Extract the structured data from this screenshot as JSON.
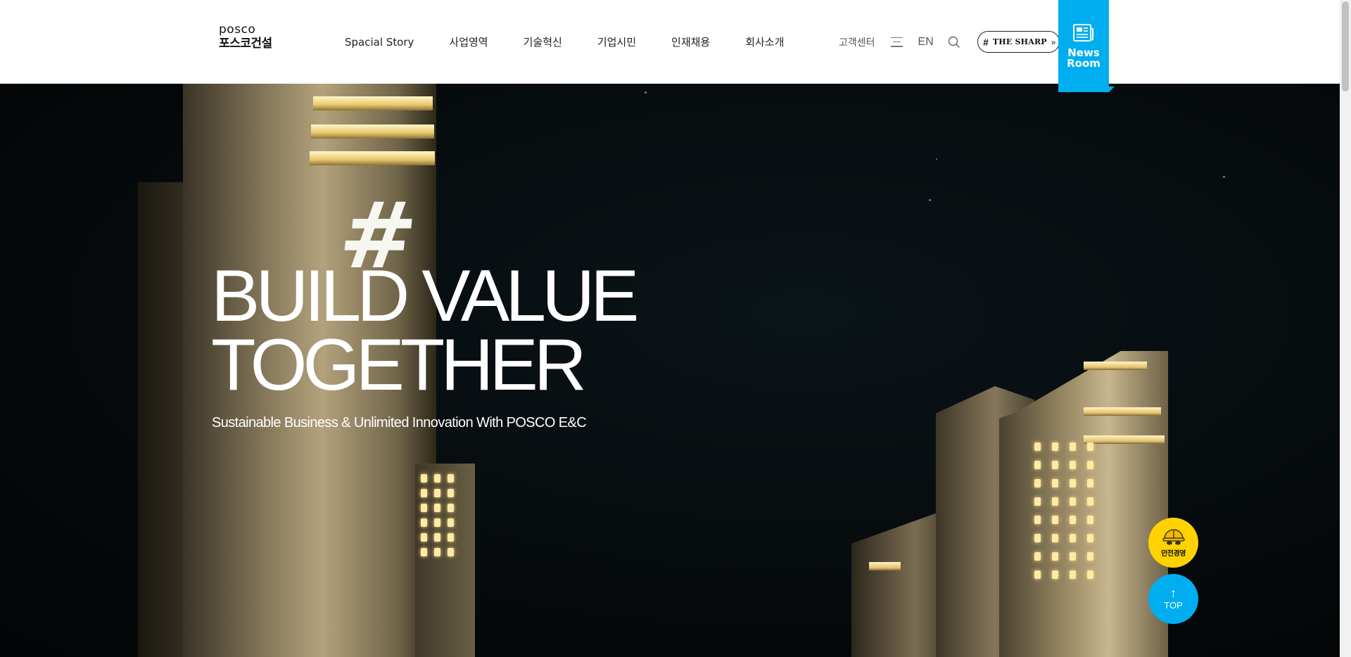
{
  "header": {
    "logo_en": "posco",
    "logo_kr": "포스코건설",
    "nav": [
      {
        "label": "Spacial Story"
      },
      {
        "label": "사업영역"
      },
      {
        "label": "기술혁신"
      },
      {
        "label": "기업시민"
      },
      {
        "label": "인재채용"
      },
      {
        "label": "회사소개"
      }
    ],
    "util": {
      "customer_center": "고객센터",
      "menu_icon": "hamburger-icon",
      "lang": "EN",
      "search_icon": "search-icon",
      "sharp_hash": "#",
      "sharp_label": "THE SHARP",
      "sharp_arrow": "»"
    },
    "newsroom": {
      "icon": "newspaper-icon",
      "label": "News\nRoom"
    }
  },
  "hero": {
    "title": "BUILD VALUE\nTOGETHER",
    "subtitle": "Sustainable Business & Unlimited Innovation With POSCO E&C",
    "building_hash": "#"
  },
  "floating": {
    "safety_label": "안전경영",
    "safety_icon": "hardhat-icon",
    "top_arrow": "↑",
    "top_label": "TOP"
  },
  "colors": {
    "accent": "#00aeef",
    "safety": "#ffd200",
    "header_bg": "#ffffff",
    "hero_bg": "#060a0c"
  }
}
